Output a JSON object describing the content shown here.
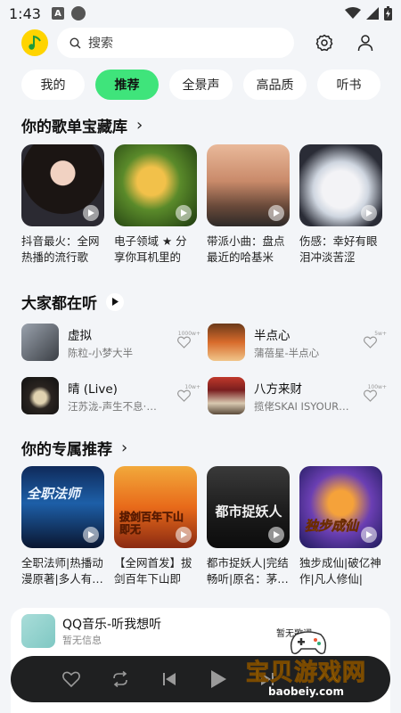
{
  "status_bar": {
    "time": "1:43",
    "a_icon_label": "A"
  },
  "header": {
    "search_placeholder": "搜索"
  },
  "tabs": [
    {
      "label": "我的",
      "active": false
    },
    {
      "label": "推荐",
      "active": true
    },
    {
      "label": "全景声",
      "active": false
    },
    {
      "label": "高品质",
      "active": false
    },
    {
      "label": "听书",
      "active": false
    }
  ],
  "section1": {
    "title": "你的歌单宝藏库",
    "cards": [
      {
        "title": "抖音最火：全网热播的流行歌"
      },
      {
        "title": "电子领域 ★ 分享你耳机里的FUNK"
      },
      {
        "title": "带派小曲：盘点最近的哈基米之…"
      },
      {
        "title": "伤感：幸好有眼泪冲淡苦涩"
      }
    ]
  },
  "section2": {
    "title": "大家都在听",
    "songs": [
      {
        "title": "虚拟",
        "artist": "陈粒-小梦大半",
        "likes": "1000w+"
      },
      {
        "title": "半点心",
        "artist": "蒲蓓星-半点心",
        "likes": "5w+"
      },
      {
        "title": "晴 (Live)",
        "artist": "汪苏泷-声生不息·华流…",
        "likes": "10w+"
      },
      {
        "title": "八方来财",
        "artist": "揽佬SKAI ISYOURGOD-…",
        "likes": "100w+"
      }
    ]
  },
  "section3": {
    "title": "你的专属推荐",
    "cards": [
      {
        "title": "全职法师|热播动漫原著|多人有…",
        "cover_text": "全职法师"
      },
      {
        "title": "【全网首发】拔剑百年下山即无…",
        "cover_text": "拔剑百年下山即无"
      },
      {
        "title": "都市捉妖人|完结畅听|原名：茅…",
        "cover_text": "都市捉妖人"
      },
      {
        "title": "独步成仙|破亿神作|凡人修仙|热…",
        "cover_text": "独步成仙"
      }
    ]
  },
  "player": {
    "title": "QQ音乐-听我想听",
    "subtitle": "暂无信息",
    "lyric_status": "暂无歌词"
  },
  "watermark": {
    "text": "宝贝游戏网",
    "url": "baobeiy.com"
  },
  "colors": {
    "accent": "#3fe47b",
    "logo": "#ffd400",
    "player_bg": "#1f2021"
  }
}
